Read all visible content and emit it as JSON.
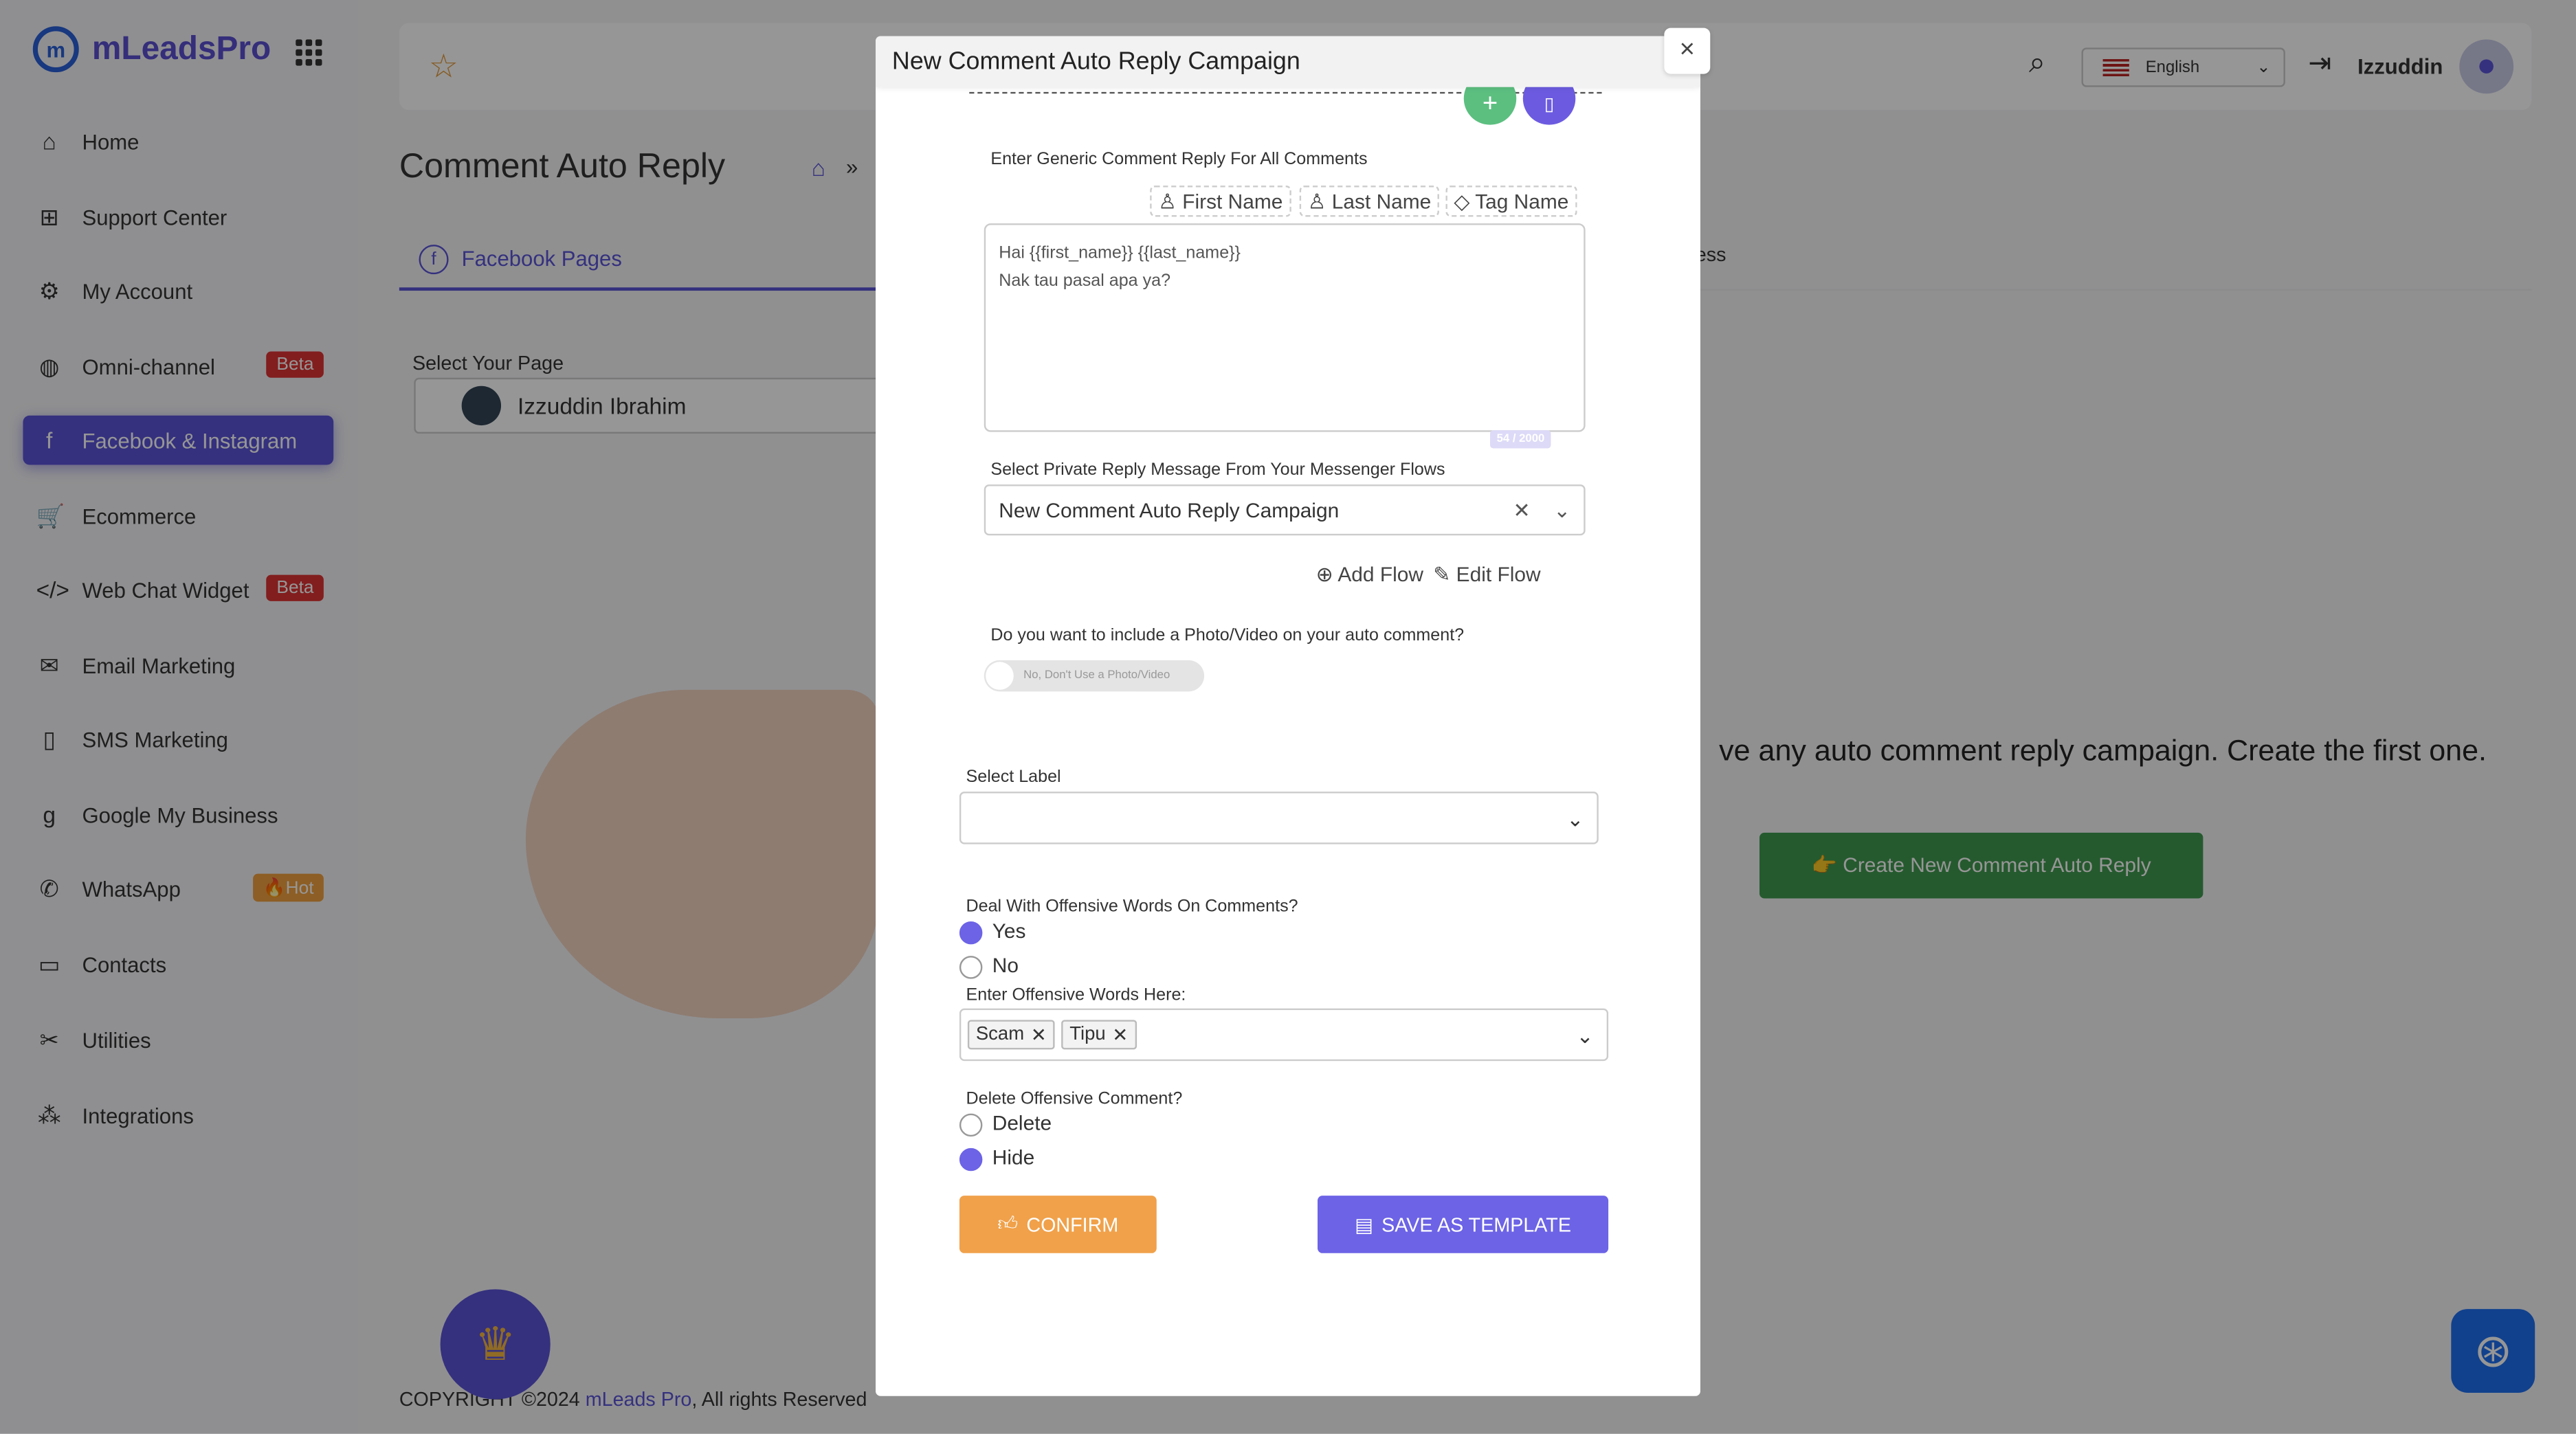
{
  "brand": {
    "name": "mLeadsPro",
    "logo_text": "m"
  },
  "sidebar": {
    "items": [
      {
        "label": "Home",
        "icon": "home-icon",
        "glyph": "⌂"
      },
      {
        "label": "Support Center",
        "icon": "support-icon",
        "glyph": "⊞"
      },
      {
        "label": "My Account",
        "icon": "gear-icon",
        "glyph": "⚙"
      },
      {
        "label": "Omni-channel",
        "icon": "globe-icon",
        "glyph": "◍",
        "badge": "Beta"
      },
      {
        "label": "Facebook & Instagram",
        "icon": "facebook-icon",
        "glyph": "f",
        "active": true
      },
      {
        "label": "Ecommerce",
        "icon": "cart-icon",
        "glyph": "🛒"
      },
      {
        "label": "Web Chat Widget",
        "icon": "code-icon",
        "glyph": "</>",
        "badge": "Beta"
      },
      {
        "label": "Email Marketing",
        "icon": "mail-icon",
        "glyph": "✉"
      },
      {
        "label": "SMS Marketing",
        "icon": "phone-icon",
        "glyph": "▯"
      },
      {
        "label": "Google My Business",
        "icon": "google-icon",
        "glyph": "g"
      },
      {
        "label": "WhatsApp",
        "icon": "whatsapp-icon",
        "glyph": "✆",
        "badge": "🔥Hot"
      },
      {
        "label": "Contacts",
        "icon": "contacts-icon",
        "glyph": "▭"
      },
      {
        "label": "Utilities",
        "icon": "tools-icon",
        "glyph": "✂"
      },
      {
        "label": "Integrations",
        "icon": "integrations-icon",
        "glyph": "⁂"
      }
    ]
  },
  "topbar": {
    "language": "English",
    "username": "Izzuddin"
  },
  "page": {
    "title": "Comment Auto Reply",
    "breadcrumb_sep": "»",
    "tab": "Facebook Pages",
    "tab_right_partial": "ess",
    "select_page_label": "Select Your Page",
    "selected_page": "Izzuddin Ibrahim",
    "empty_message": "ve any auto comment reply campaign. Create the first one.",
    "create_button": "👉 Create New Comment Auto Reply",
    "footer_prefix": "COPYRIGHT ©2024 ",
    "footer_link": "mLeads Pro",
    "footer_suffix": ", All rights Reserved"
  },
  "modal": {
    "title": "New Comment Auto Reply Campaign",
    "close": "×",
    "generic_label": "Enter Generic Comment Reply For All Comments",
    "chips": [
      "First Name",
      "Last Name",
      "Tag Name"
    ],
    "reply_text_line1": "Hai {{first_name}} {{last_name}}",
    "reply_text_line2": "Nak tau pasal apa ya?",
    "char_count": "54 / 2000",
    "private_reply_label": "Select Private Reply Message From Your Messenger Flows",
    "private_reply_value": "New Comment Auto Reply Campaign",
    "add_flow": "Add Flow",
    "edit_flow": "Edit Flow",
    "photo_question": "Do you want to include a Photo/Video on your auto comment?",
    "photo_toggle_label": "No, Don't Use a Photo/Video",
    "photo_toggle_on": false,
    "select_label": "Select Label",
    "select_label_value": "",
    "offensive_question": "Deal With Offensive Words On Comments?",
    "offensive_options": [
      "Yes",
      "No"
    ],
    "offensive_selected": "Yes",
    "offensive_words_label": "Enter Offensive Words Here:",
    "offensive_words": [
      "Scam",
      "Tipu"
    ],
    "delete_question": "Delete Offensive Comment?",
    "delete_options": [
      "Delete",
      "Hide"
    ],
    "delete_selected": "Hide",
    "confirm": "CONFIRM",
    "save_template": "SAVE AS TEMPLATE"
  },
  "colors": {
    "primary": "#6c63e6",
    "confirm": "#f0a14a",
    "create": "#3f9a4f",
    "beta": "#d33a3a"
  }
}
